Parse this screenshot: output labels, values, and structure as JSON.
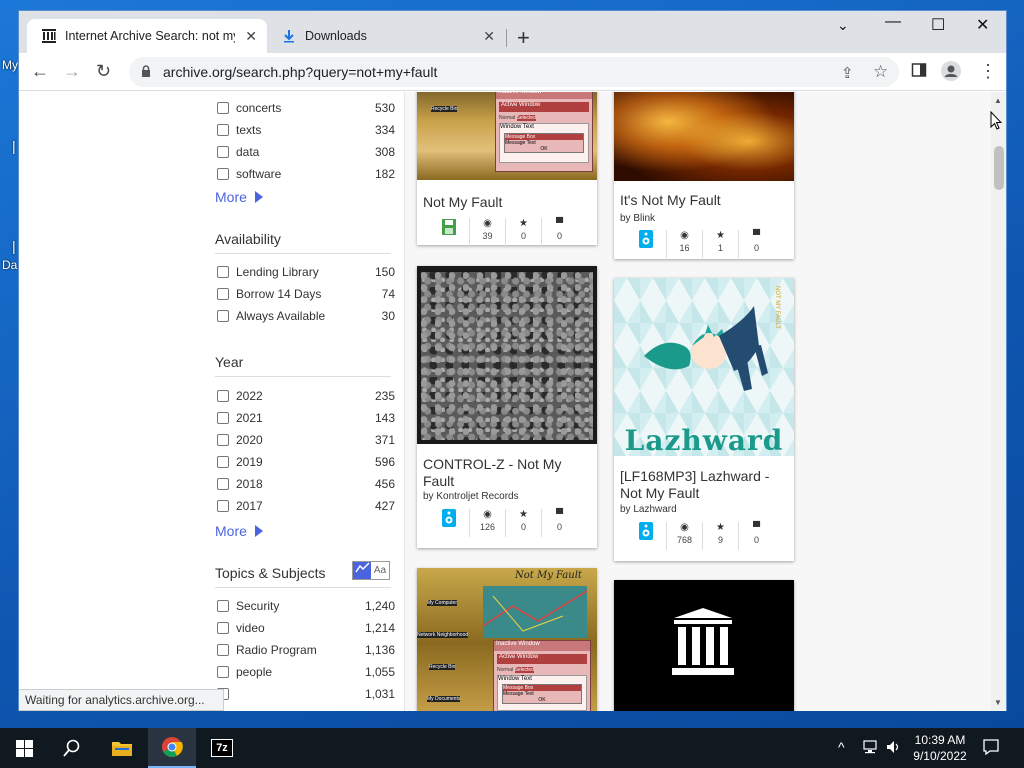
{
  "desktop": {
    "icon_labels": [
      "My",
      "Da"
    ]
  },
  "browser": {
    "tabs": [
      {
        "title": "Internet Archive Search: not my f",
        "active": true
      },
      {
        "title": "Downloads",
        "active": false
      }
    ],
    "url": "archive.org/search.php?query=not+my+fault",
    "status": "Waiting for analytics.archive.org..."
  },
  "facets": {
    "mediatype_rows": [
      {
        "label": "concerts",
        "count": "530"
      },
      {
        "label": "texts",
        "count": "334"
      },
      {
        "label": "data",
        "count": "308"
      },
      {
        "label": "software",
        "count": "182"
      }
    ],
    "more_label": "More",
    "availability": {
      "title": "Availability",
      "rows": [
        {
          "label": "Lending Library",
          "count": "150"
        },
        {
          "label": "Borrow 14 Days",
          "count": "74"
        },
        {
          "label": "Always Available",
          "count": "30"
        }
      ]
    },
    "year": {
      "title": "Year",
      "rows": [
        {
          "label": "2022",
          "count": "235"
        },
        {
          "label": "2021",
          "count": "143"
        },
        {
          "label": "2020",
          "count": "371"
        },
        {
          "label": "2019",
          "count": "596"
        },
        {
          "label": "2018",
          "count": "456"
        },
        {
          "label": "2017",
          "count": "427"
        }
      ]
    },
    "topics": {
      "title": "Topics & Subjects",
      "text_toggle": "Aa",
      "rows": [
        {
          "label": "Security",
          "count": "1,240"
        },
        {
          "label": "video",
          "count": "1,214"
        },
        {
          "label": "Radio Program",
          "count": "1,136"
        },
        {
          "label": "people",
          "count": "1,055"
        },
        {
          "label": "",
          "count": "1,031"
        }
      ]
    }
  },
  "results": [
    {
      "title": "Not My Fault",
      "by": "",
      "mediatype_icon": "software-floppy-icon",
      "views": "39",
      "favorites": "0",
      "reviews": "0"
    },
    {
      "title": "It's Not My Fault",
      "by": "by Blink",
      "mediatype_icon": "audio-icon",
      "views": "16",
      "favorites": "1",
      "reviews": "0"
    },
    {
      "title": "CONTROL-Z - Not My Fault",
      "by": "by Kontroljet Records",
      "mediatype_icon": "audio-icon",
      "views": "126",
      "favorites": "0",
      "reviews": "0"
    },
    {
      "title": "[LF168MP3] Lazhward - Not My Fault",
      "by": "by Lazhward",
      "mediatype_icon": "audio-icon",
      "views": "768",
      "favorites": "9",
      "reviews": "0"
    },
    {
      "title": "",
      "by": "",
      "mediatype_icon": "",
      "views": "",
      "favorites": "",
      "reviews": ""
    },
    {
      "title": "",
      "by": "",
      "mediatype_icon": "",
      "views": "",
      "favorites": "",
      "reviews": ""
    }
  ],
  "thumb_text": {
    "win_title": "Inactive Window",
    "active_window": "Active Window",
    "normal": "Normal",
    "selected": "Selected",
    "window_text": "Window Text",
    "message_box": "Message Box",
    "message_text": "Message Text",
    "ok": "OK",
    "recycle_bin": "Recycle Bin",
    "not_my_fault_script": "Not My Fault",
    "my_computer": "My Computer",
    "network": "Network Neighborhood",
    "my_documents": "My Documents",
    "lazhward_logo": "Lazhward",
    "lazhward_side": "NOT MY FAULT"
  },
  "taskbar": {
    "time": "10:39 AM",
    "date": "9/10/2022",
    "seven_zip": "7z"
  },
  "colors": {
    "accent": "#4b64de",
    "taskbar": "#101820",
    "desktop": "#1468c4"
  }
}
